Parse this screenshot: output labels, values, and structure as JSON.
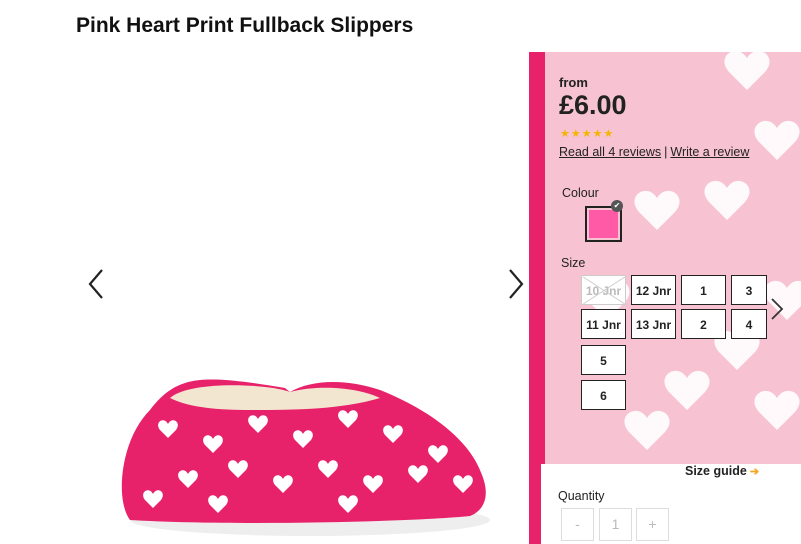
{
  "product": {
    "title": "Pink Heart Print Fullback Slippers"
  },
  "pricing": {
    "from_label": "from",
    "price": "£6.00"
  },
  "rating": {
    "stars": 4.5,
    "read_reviews_link": "Read all 4 reviews",
    "separator": "|",
    "write_review_link": "Write a review"
  },
  "colour": {
    "label": "Colour",
    "selected_hex": "#ff5aa5"
  },
  "size": {
    "label": "Size",
    "options": [
      {
        "label": "10 Jnr",
        "available": false
      },
      {
        "label": "12 Jnr",
        "available": true
      },
      {
        "label": "1",
        "available": true
      },
      {
        "label": "3",
        "available": true
      },
      {
        "label": "11 Jnr",
        "available": true
      },
      {
        "label": "13 Jnr",
        "available": true
      },
      {
        "label": "2",
        "available": true
      },
      {
        "label": "4",
        "available": true
      },
      {
        "label": "5",
        "available": true
      },
      {
        "label": "6",
        "available": true
      }
    ],
    "guide_label": "Size guide"
  },
  "quantity": {
    "label": "Quantity",
    "minus": "-",
    "value": "1",
    "plus": "+"
  },
  "colors": {
    "star": "#f5b400",
    "slipper_pink": "#e8226a",
    "accent_arrow": "#f5a623"
  },
  "icons": {
    "prev": "chevron-left-icon",
    "next": "chevron-right-icon",
    "size_next": "chevron-right-icon"
  }
}
